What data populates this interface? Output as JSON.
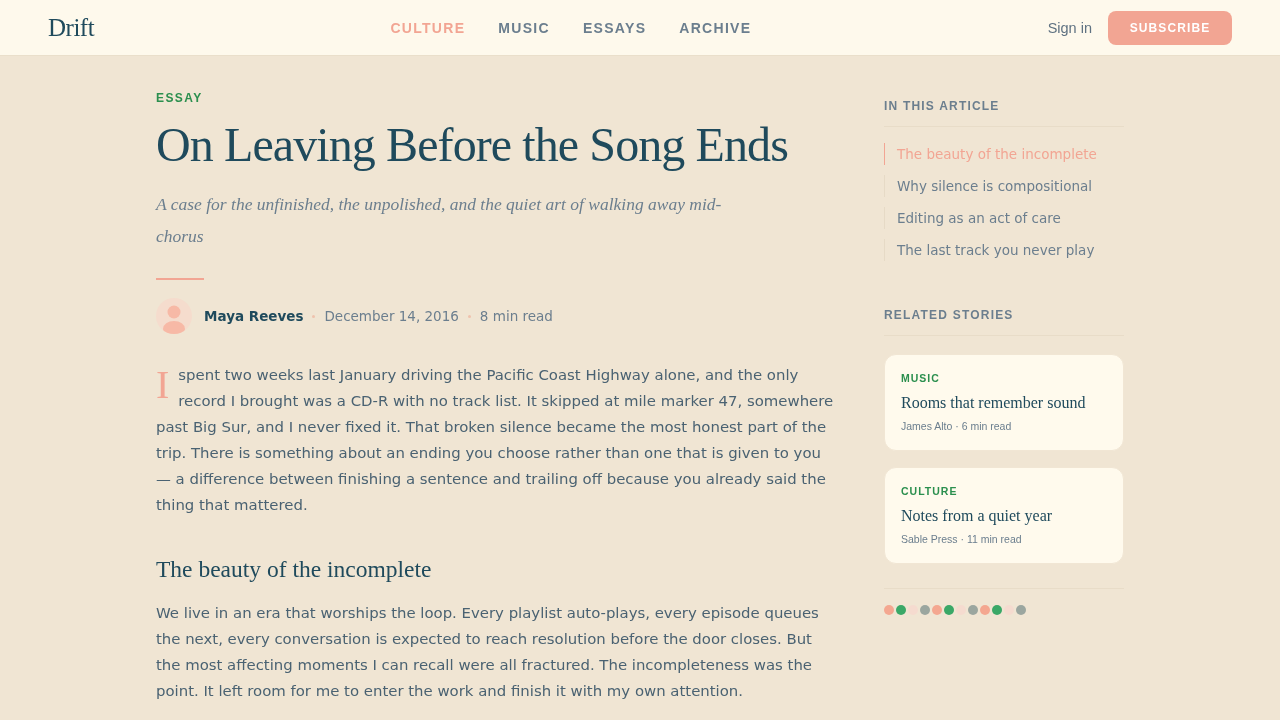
{
  "header": {
    "logo": "Drift",
    "nav": [
      {
        "label": "CULTURE",
        "selected": true
      },
      {
        "label": "MUSIC",
        "selected": false
      },
      {
        "label": "ESSAYS",
        "selected": false
      },
      {
        "label": "ARCHIVE",
        "selected": false
      }
    ],
    "sign_in": "Sign in",
    "subscribe": "SUBSCRIBE"
  },
  "article": {
    "category": "ESSAY",
    "title": "On Leaving Before the Song Ends",
    "subtitle": "A case for the unfinished, the unpolished, and the quiet art of walking away mid-chorus",
    "byline": {
      "author": "Maya Reeves",
      "date": "December 14, 2016",
      "read_time": "8 min read"
    },
    "body": [
      {
        "kind": "paragraph",
        "drop_cap": "I",
        "text": "spent two weeks last January driving the Pacific Coast Highway alone, and the only record I brought was a CD-R with no track list. It skipped at mile marker 47, somewhere past Big Sur, and I never fixed it. That broken silence became the most honest part of the trip. There is something about an ending you choose rather than one that is given to you — a difference between finishing a sentence and trailing off because you already said the thing that mattered."
      },
      {
        "kind": "heading",
        "text": "The beauty of the incomplete"
      },
      {
        "kind": "paragraph",
        "text": "We live in an era that worships the loop. Every playlist auto-plays, every episode queues the next, every conversation is expected to reach resolution before the door closes. But the most affecting moments I can recall were all fractured. The incompleteness was the point. It left room for me to enter the work and finish it with my own attention."
      }
    ]
  },
  "sidebar": {
    "toc": {
      "heading": "IN THIS ARTICLE",
      "items": [
        {
          "label": "The beauty of the incomplete",
          "selected": true
        },
        {
          "label": "Why silence is compositional",
          "selected": false
        },
        {
          "label": "Editing as an act of care",
          "selected": false
        },
        {
          "label": "The last track you never play",
          "selected": false
        }
      ]
    },
    "related": {
      "heading": "RELATED STORIES",
      "stories": [
        {
          "category": "MUSIC",
          "title": "Rooms that remember sound",
          "meta": "James Alto · 6 min read"
        },
        {
          "category": "CULTURE",
          "title": "Notes from a quiet year",
          "meta": "Sable Press · 11 min read"
        }
      ]
    },
    "dots": [
      {
        "color": "#f4a790"
      },
      {
        "color": "#3aa867"
      },
      {
        "color": "#f5dbcf"
      },
      {
        "color": "#9ba69f"
      },
      {
        "color": "#f4a790"
      },
      {
        "color": "#3aa867"
      },
      {
        "color": "#f5dbcf"
      },
      {
        "color": "#9ba69f"
      },
      {
        "color": "#f4a790"
      },
      {
        "color": "#3aa867"
      },
      {
        "color": "#f5dbcf"
      },
      {
        "color": "#9ba69f"
      }
    ]
  }
}
